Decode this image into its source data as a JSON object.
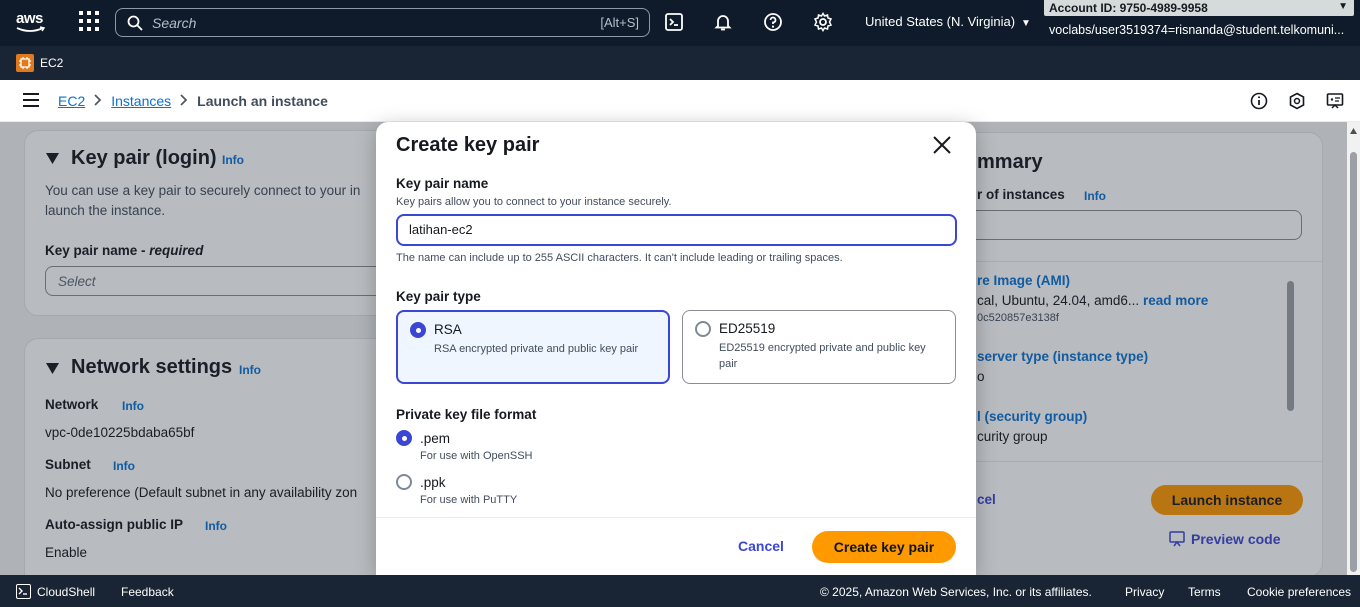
{
  "topnav": {
    "logo_text": "aws",
    "search_placeholder": "Search",
    "search_shortcut": "[Alt+S]",
    "region": "United States (N. Virginia)",
    "account_id": "Account ID: 9750-4989-9958",
    "user": "voclabs/user3519374=risnanda@student.telkomuni..."
  },
  "servicebar": {
    "service": "EC2"
  },
  "breadcrumb": {
    "ec2": "EC2",
    "instances": "Instances",
    "current": "Launch an instance"
  },
  "background": {
    "keypair": {
      "title": "Key pair (login)",
      "info": "Info",
      "desc_line1": "You can use a key pair to securely connect to your in",
      "desc_line2": "launch the instance.",
      "name_label": "Key pair name - ",
      "name_label_italic": "required",
      "select_placeholder": "Select"
    },
    "network": {
      "title": "Network settings",
      "info": "Info",
      "network_label": "Network",
      "network_value": "vpc-0de10225bdaba65bf",
      "subnet_label": "Subnet",
      "subnet_value": "No preference (Default subnet in any availability zon",
      "public_ip_label": "Auto-assign public IP",
      "public_ip_value": "Enable"
    },
    "summary": {
      "title": "mmary",
      "instances_label": "r of instances",
      "info": "Info",
      "ami_label": "re Image (AMI)",
      "ami_value": "cal, Ubuntu, 24.04, amd6...",
      "ami_more": "read more",
      "ami_id": "0c520857e3138f",
      "type_label": "server type (instance type)",
      "type_value": "o",
      "sg_label": "l (security group)",
      "sg_value": "curity group",
      "cancel": "cel",
      "launch": "Launch instance",
      "preview": "Preview code"
    }
  },
  "modal": {
    "title": "Create key pair",
    "name_label": "Key pair name",
    "name_desc": "Key pairs allow you to connect to your instance securely.",
    "name_value": "latihan-ec2",
    "name_hint": "The name can include up to 255 ASCII characters. It can't include leading or trailing spaces.",
    "type_label": "Key pair type",
    "types": [
      {
        "title": "RSA",
        "desc": "RSA encrypted private and public key pair",
        "selected": true
      },
      {
        "title": "ED25519",
        "desc": "ED25519 encrypted private and public key pair",
        "selected": false
      }
    ],
    "format_label": "Private key file format",
    "formats": [
      {
        "title": ".pem",
        "desc": "For use with OpenSSH",
        "selected": true
      },
      {
        "title": ".ppk",
        "desc": "For use with PuTTY",
        "selected": false
      }
    ],
    "cancel": "Cancel",
    "create": "Create key pair"
  },
  "bottombar": {
    "cloudshell": "CloudShell",
    "feedback": "Feedback",
    "copyright": "© 2025, Amazon Web Services, Inc. or its affiliates.",
    "privacy": "Privacy",
    "terms": "Terms",
    "cookies": "Cookie preferences"
  },
  "colors": {
    "nav": "#0f1b2a",
    "accent": "#3c46d4",
    "primary_button": "#ff9900"
  }
}
